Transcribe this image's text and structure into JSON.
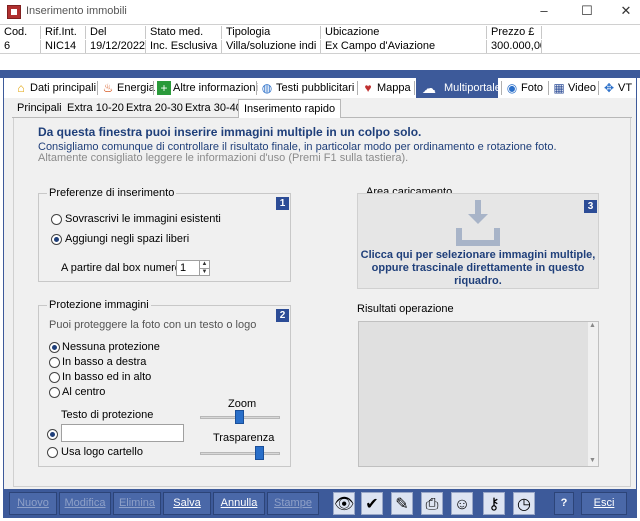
{
  "window": {
    "title": "Inserimento immobili",
    "min": "–",
    "max": "☐",
    "close": "✕"
  },
  "grid": {
    "headers": [
      "Cod.",
      "Rif.Int.",
      "Del",
      "Stato med.",
      "Tipologia",
      "Ubicazione",
      "Prezzo £"
    ],
    "rows": [
      [
        "6",
        "NIC14",
        "19/12/2022",
        "Inc. Esclusiva",
        "Villa/soluzione indi",
        "Ex Campo d'Aviazione",
        "300.000,00"
      ]
    ]
  },
  "tabs": [
    "Dati principali",
    "Energia",
    "Altre informazioni",
    "Testi pubblicitari",
    "Mappa",
    "Multiportale",
    "Foto",
    "Video",
    "VT"
  ],
  "subtabs": [
    "Principali",
    "Extra 10-20",
    "Extra 20-30",
    "Extra 30-40",
    "Inserimento rapido"
  ],
  "intro": {
    "line1": "Da questa finestra puoi inserire immagini multiple in un colpo solo.",
    "line2": "Consigliamo comunque di controllare il risultato finale, in particolar modo per ordinamento e rotazione foto.",
    "line3": "Altamente consigliato leggere le informazioni d'uso (Premi F1 sulla tastiera)."
  },
  "pref": {
    "title": "Preferenze di inserimento",
    "num": "1",
    "opt1": "Sovrascrivi le immagini esistenti",
    "opt2": "Aggiungi negli spazi liberi",
    "start_label": "A partire dal box numero",
    "start_value": "1"
  },
  "prot": {
    "title": "Protezione immagini",
    "num": "2",
    "hint": "Puoi proteggere la foto con un testo o logo",
    "options": [
      "Nessuna protezione",
      "In basso a destra",
      "In basso ed in alto",
      "Al centro"
    ],
    "text_label": "Testo di protezione",
    "text_value": "",
    "logo_label": "Usa logo cartello",
    "zoom_label": "Zoom",
    "trasp_label": "Trasparenza",
    "zoom_level": 0.5,
    "trasp_level": 0.75
  },
  "upload": {
    "title": "Area caricamento",
    "num": "3",
    "text": "Clicca qui per selezionare immagini multiple, oppure trascinale direttamente in questo riquadro."
  },
  "results": {
    "title": "Risultati operazione"
  },
  "toolbar": {
    "nuovo": "Nuovo",
    "modifica": "Modifica",
    "elimina": "Elimina",
    "salva": "Salva",
    "annulla": "Annulla",
    "stampe": "Stampe",
    "esci": "Esci",
    "help": "?"
  },
  "colors": {
    "accent": "#3d5a9a",
    "heading": "#1f3f7a"
  }
}
